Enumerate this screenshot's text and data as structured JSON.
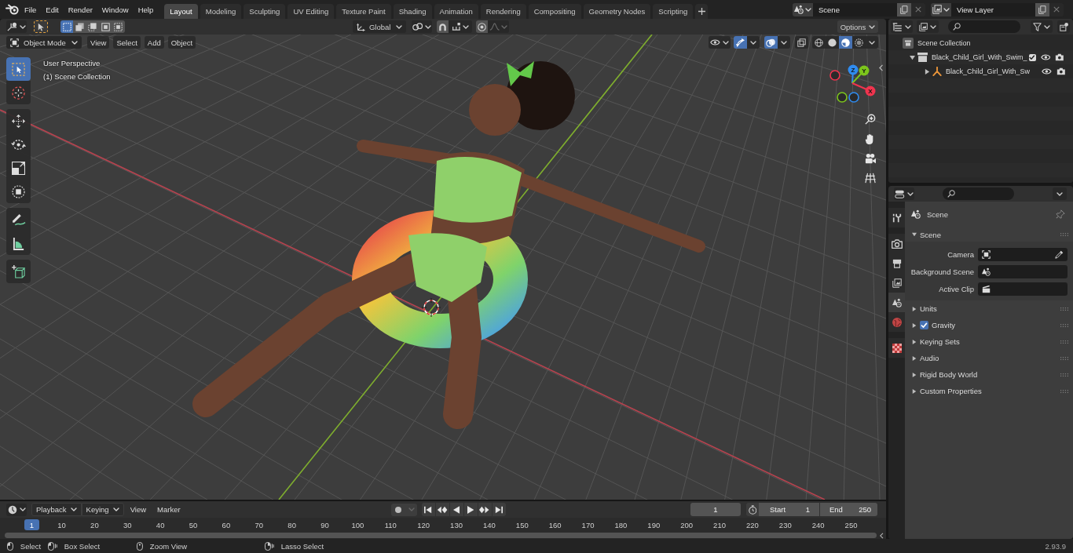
{
  "top_bar": {
    "menus": [
      "File",
      "Edit",
      "Render",
      "Window",
      "Help"
    ],
    "workspaces": [
      {
        "label": "Layout",
        "selected": true
      },
      {
        "label": "Modeling",
        "selected": false
      },
      {
        "label": "Sculpting",
        "selected": false
      },
      {
        "label": "UV Editing",
        "selected": false
      },
      {
        "label": "Texture Paint",
        "selected": false
      },
      {
        "label": "Shading",
        "selected": false
      },
      {
        "label": "Animation",
        "selected": false
      },
      {
        "label": "Rendering",
        "selected": false
      },
      {
        "label": "Compositing",
        "selected": false
      },
      {
        "label": "Geometry Nodes",
        "selected": false
      },
      {
        "label": "Scripting",
        "selected": false
      }
    ],
    "scene": "Scene",
    "view_layer": "View Layer"
  },
  "viewport_header": {
    "select_modes": [
      {
        "kind": "set",
        "selected": true
      },
      {
        "kind": "extend",
        "selected": false
      },
      {
        "kind": "subtract",
        "selected": false
      },
      {
        "kind": "invert",
        "selected": false
      },
      {
        "kind": "intersect",
        "selected": false
      }
    ],
    "orientation": "Global",
    "snap": false,
    "proportional": false,
    "options": "Options"
  },
  "tool_header": {
    "mode": "Object Mode",
    "menus": [
      "View",
      "Select",
      "Add",
      "Object"
    ],
    "gizmos": true,
    "overlays": true,
    "xray": false,
    "shading": [
      {
        "kind": "wireframe",
        "selected": false
      },
      {
        "kind": "solid",
        "selected": false
      },
      {
        "kind": "material",
        "selected": true
      },
      {
        "kind": "rendered",
        "selected": false
      }
    ]
  },
  "viewport": {
    "view_name": "User Perspective",
    "collection": "(1) Scene Collection",
    "tool_groups": [
      {
        "tools": [
          {
            "kind": "select",
            "selected": true
          },
          {
            "kind": "cursor",
            "selected": false
          }
        ]
      },
      {
        "tools": [
          {
            "kind": "move",
            "selected": false
          },
          {
            "kind": "rotate",
            "selected": false
          },
          {
            "kind": "scale",
            "selected": false
          },
          {
            "kind": "transform",
            "selected": false
          }
        ]
      },
      {
        "tools": [
          {
            "kind": "annotate",
            "selected": false
          },
          {
            "kind": "measure",
            "selected": false
          }
        ]
      },
      {
        "tools": [
          {
            "kind": "add_cube",
            "selected": false
          }
        ]
      }
    ],
    "axes": [
      {
        "kind": "z",
        "label": "Z",
        "color": "#2f8cf0"
      },
      {
        "kind": "y",
        "label": "Y",
        "color": "#7cc51c"
      },
      {
        "kind": "x",
        "label": "X",
        "color": "#f0344e"
      }
    ]
  },
  "outliner": {
    "tree": [
      {
        "label": "Scene Collection",
        "kind": "scene_collection",
        "children": [
          {
            "label": "Black_Child_Girl_With_Swim_",
            "kind": "collection",
            "expanded": true,
            "checked": true,
            "children": [
              {
                "label": "Black_Child_Girl_With_Sw",
                "kind": "armature",
                "expanded": false
              }
            ]
          }
        ]
      }
    ]
  },
  "properties": {
    "tab_groups": [
      {
        "tabs": [
          {
            "kind": "tool",
            "selected": false
          }
        ]
      },
      {
        "tabs": [
          {
            "kind": "render",
            "selected": false
          },
          {
            "kind": "output",
            "selected": false
          },
          {
            "kind": "view_layer",
            "selected": false
          },
          {
            "kind": "scene",
            "selected": true
          },
          {
            "kind": "world",
            "selected": false
          }
        ]
      },
      {
        "tabs": [
          {
            "kind": "texture",
            "selected": false
          }
        ]
      }
    ],
    "context": "Scene",
    "panels": [
      {
        "title": "Scene",
        "expanded": true,
        "fields": [
          {
            "label": "Camera",
            "kind": "camera"
          },
          {
            "label": "Background Scene",
            "kind": "scene"
          },
          {
            "label": "Active Clip",
            "kind": "clip"
          }
        ]
      },
      {
        "title": "Units",
        "expanded": false
      },
      {
        "title": "Gravity",
        "expanded": false,
        "checked": true
      },
      {
        "title": "Keying Sets",
        "expanded": false
      },
      {
        "title": "Audio",
        "expanded": false
      },
      {
        "title": "Rigid Body World",
        "expanded": false
      },
      {
        "title": "Custom Properties",
        "expanded": false
      }
    ]
  },
  "timeline": {
    "dropdowns": [
      "Playback",
      "Keying"
    ],
    "menus": [
      "View",
      "Marker"
    ],
    "auto_keying": false,
    "current_frame": "1",
    "start_label": "Start",
    "start": "1",
    "end_label": "End",
    "end": "250",
    "playhead": "1",
    "ruler": [
      "10",
      "20",
      "30",
      "40",
      "50",
      "60",
      "70",
      "80",
      "90",
      "100",
      "110",
      "120",
      "130",
      "140",
      "150",
      "160",
      "170",
      "180",
      "190",
      "200",
      "210",
      "220",
      "230",
      "240",
      "250"
    ]
  },
  "status_bar": {
    "hints": [
      {
        "kind": "left_click",
        "label": "Select"
      },
      {
        "kind": "left_drag",
        "label": "Box Select"
      },
      {
        "kind": "middle",
        "label": "Zoom View"
      },
      {
        "kind": "right_drag",
        "label": "Lasso Select"
      }
    ],
    "version": "2.93.9"
  }
}
